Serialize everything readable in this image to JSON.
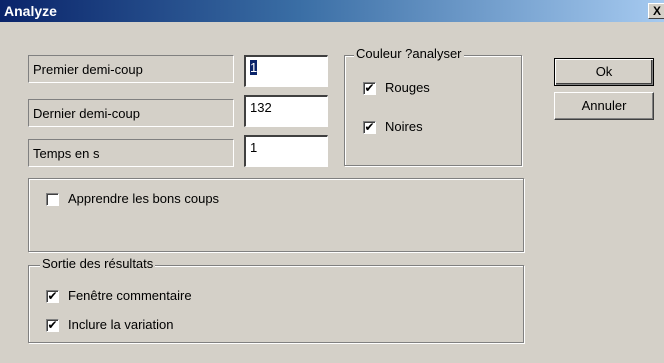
{
  "window": {
    "title": "Analyze",
    "close_glyph": "X"
  },
  "fields": [
    {
      "label": "Premier demi-coup",
      "value": "1"
    },
    {
      "label": "Dernier demi-coup",
      "value": "132"
    },
    {
      "label": "Temps en s",
      "value": "1"
    }
  ],
  "color_group": {
    "legend": "Couleur ?analyser",
    "options": [
      {
        "label": "Rouges",
        "checked": true
      },
      {
        "label": "Noires",
        "checked": true
      }
    ]
  },
  "learn_group": {
    "option": {
      "label": "Apprendre les bons coups",
      "checked": false
    }
  },
  "output_group": {
    "legend": "Sortie des résultats",
    "options": [
      {
        "label": "Fenêtre commentaire",
        "checked": true
      },
      {
        "label": "Inclure la variation",
        "checked": true
      }
    ]
  },
  "buttons": {
    "ok": "Ok",
    "cancel": "Annuler"
  },
  "check_glyph": "✔"
}
